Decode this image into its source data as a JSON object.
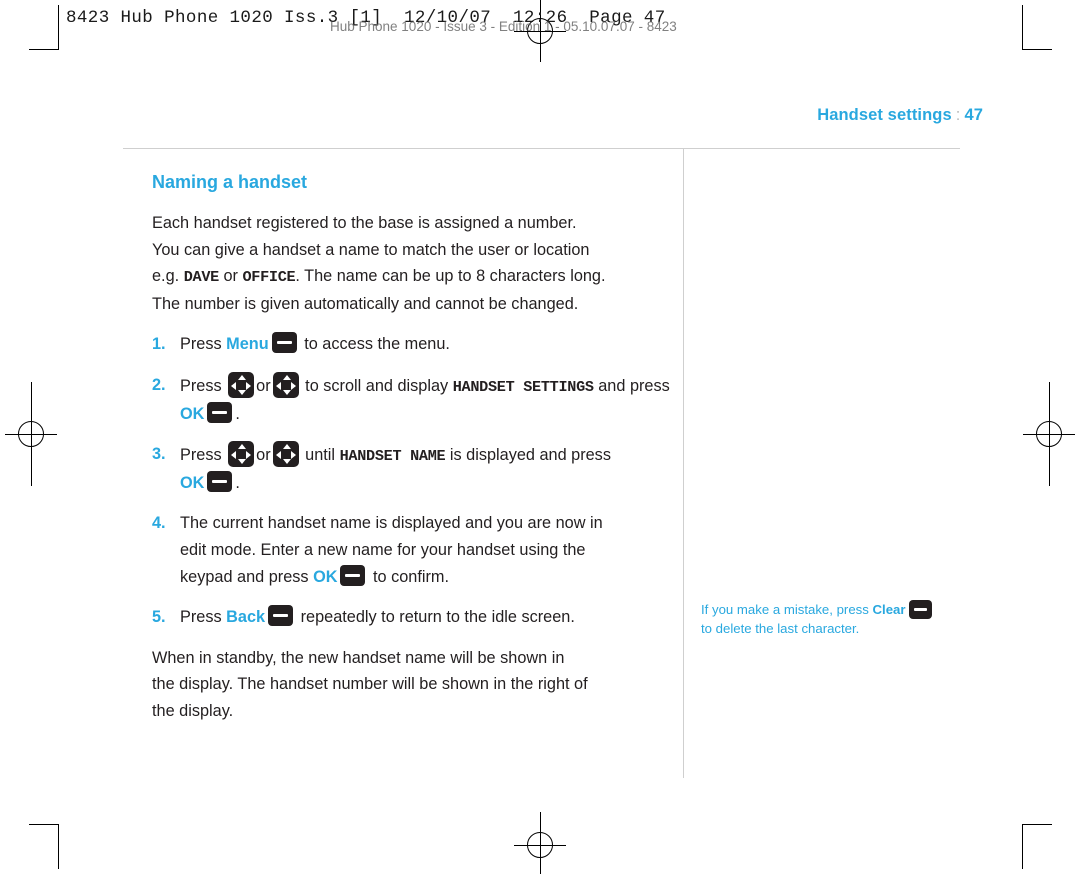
{
  "print_marks": {
    "slug_text": "8423 Hub Phone 1020 Iss.3 [1]  12/10/07  12:26  Page 47",
    "running_head": "Hub Phone 1020 - Issue 3 - Edition 1 - 05.10.07.07 - 8423"
  },
  "header": {
    "running_title": "Handset settings",
    "separator": ":",
    "page_number": "47"
  },
  "content": {
    "section_title": "Naming a handset",
    "intro_line1": "Each handset registered to the base is assigned a number.",
    "intro_line2": "You can give a handset a name to match the user or location",
    "intro_line3_pre": "e.g. ",
    "intro_name_1": "DAVE",
    "intro_line3_mid": " or ",
    "intro_name_2": "OFFICE",
    "intro_line3_post": ". The name can be up to 8 characters long.",
    "intro_line4": "The number is given automatically and cannot be changed.",
    "steps": [
      {
        "marker": "1.",
        "pre": "Press ",
        "key": "Menu",
        "post": " to access the menu."
      },
      {
        "marker": "2.",
        "pre": "Press ",
        "mid": "or",
        "post": " to scroll and display ",
        "display_text": "HANDSET SETTINGS",
        "tail_pre": "and press ",
        "tail_key": "OK",
        "tail_post": "."
      },
      {
        "marker": "3.",
        "pre": "Press ",
        "mid": "or",
        "post": " until ",
        "display_text": "HANDSET NAME",
        "tail_pre": " is displayed and press ",
        "tail_key": "OK",
        "tail_post": "."
      },
      {
        "marker": "4.",
        "line1": "The current handset name is displayed and you are now in",
        "line2": "edit mode. Enter a new name for your handset using the",
        "line3_pre": "keypad and press ",
        "key": "OK",
        "line3_post": " to confirm."
      },
      {
        "marker": "5.",
        "pre": "Press ",
        "key": "Back",
        "post": " repeatedly to return to the idle screen."
      }
    ],
    "closing_line1": "When in standby, the new handset name will be shown in",
    "closing_line2": "the display. The handset number will be shown in the right of",
    "closing_line3": "the display."
  },
  "sidenote": {
    "pre": "If you make a mistake, press ",
    "key": "Clear",
    "post": "to delete the last character."
  },
  "icons": {
    "softkey": "softkey-button-icon",
    "navkey_updown": "navigation-key-up-down-icon",
    "navkey_leftright": "navigation-key-left-right-icon"
  },
  "colors": {
    "accent": "#29a8df",
    "text": "#231f20",
    "rule": "#cfcfcf"
  }
}
